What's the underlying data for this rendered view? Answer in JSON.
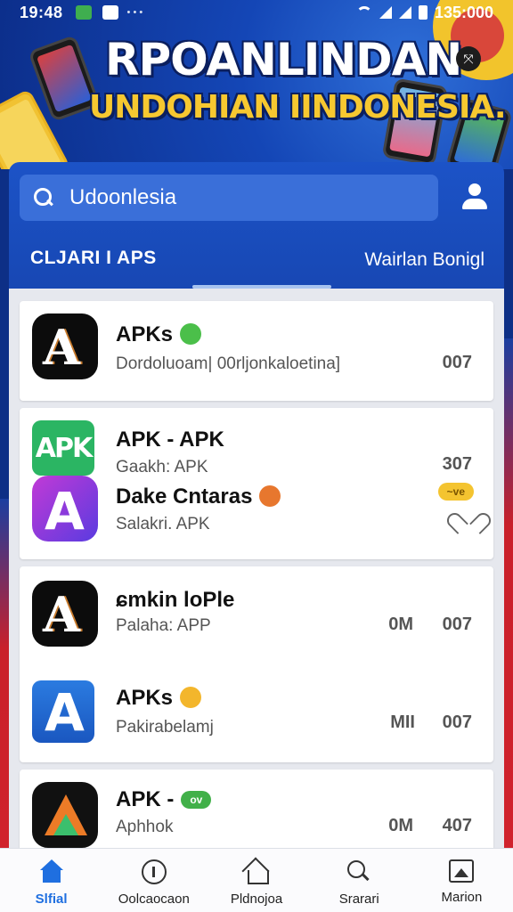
{
  "status_bar": {
    "time": "19:48",
    "dots": "• • •",
    "right_text": "135:000"
  },
  "banner": {
    "title_line1": "RPOANLINDAN",
    "title_line2": "UNDOHIAN IINDONESIA.",
    "share_icon": "share-icon"
  },
  "search": {
    "value": "Udoonlesia",
    "icon": "search-icon",
    "profile_icon": "profile-icon"
  },
  "tabs": {
    "left_label": "CLJARI I APS",
    "right_label": "Wairlan Bonigl"
  },
  "apps": [
    {
      "title": "APKs",
      "subtitle": "Dordoluoam| 00rljonkaloetina]",
      "value": "007",
      "badge_color": "#4bbf4a"
    },
    {
      "title": "APK - APK",
      "subtitle": "Gaakh: APK",
      "value": "307",
      "badge_color": ""
    },
    {
      "title": "Dake Cntaras",
      "subtitle": "Salakri. APK",
      "value": "",
      "badge_color": "#e7772e",
      "pill_text": "~ve",
      "pill_color": "#f4c430"
    },
    {
      "title": "ɕmkin loPle",
      "subtitle": "Palaha: APP",
      "extra": "0M",
      "value": "007"
    },
    {
      "title": "APKs",
      "subtitle": "Pakirabelamj",
      "extra": "MII",
      "value": "007",
      "badge_color": "#f3b62c"
    },
    {
      "title": "APK -",
      "subtitle": "Aphhok",
      "extra": "0M",
      "value": "407",
      "pill_text": "ov",
      "pill_color": "#41b049"
    }
  ],
  "bottom_nav": [
    {
      "label": "Slfial",
      "icon": "home-icon",
      "active": true
    },
    {
      "label": "Oolcaocaon",
      "icon": "compass-icon",
      "active": false
    },
    {
      "label": "Pldnojoa",
      "icon": "house-icon",
      "active": false
    },
    {
      "label": "Srarari",
      "icon": "magnify-icon",
      "active": false
    },
    {
      "label": "Marion",
      "icon": "image-icon",
      "active": false
    }
  ],
  "colors": {
    "primary": "#1c53c7",
    "active_nav": "#1f6fe0",
    "banner_yellow": "#f7c830"
  }
}
